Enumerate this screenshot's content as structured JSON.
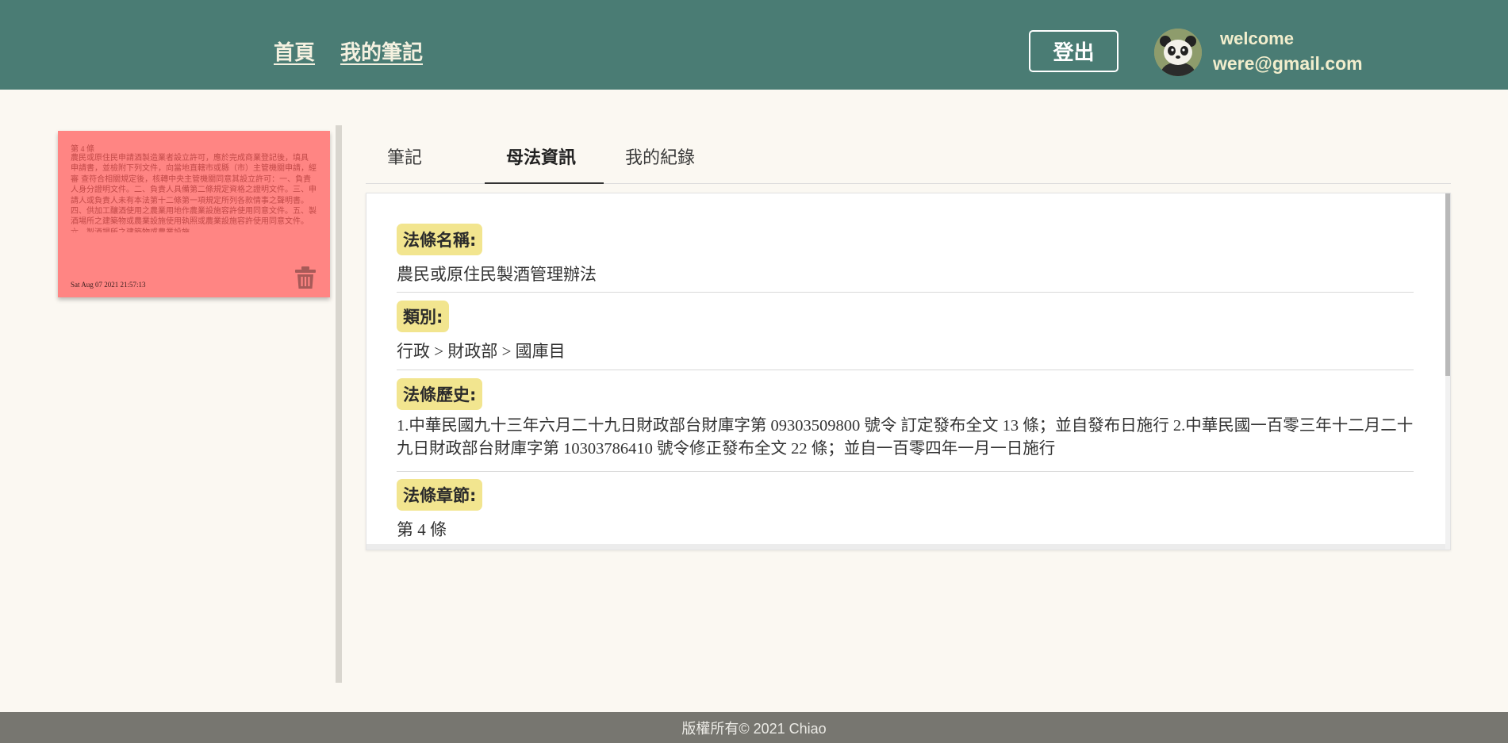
{
  "header": {
    "nav": {
      "home": "首頁",
      "my_notes": "我的筆記"
    },
    "logout_label": "登出",
    "welcome_text": "welcome",
    "email": "were@gmail.com"
  },
  "note_card": {
    "title": "第 4 條",
    "body": "農民或原住民申請酒製造業者設立許可，應於完成商業登記後，填具 申請書，並檢附下列文件，向當地直轄市或縣（市）主管機關申請，經審 查符合相關規定後，核轉中央主管機關同意其設立許可：一、負責人身分證明文件。二、負責人具備第二條規定資格之證明文件。三、申請人或負責人未有本法第十二條第一項規定所列各款情事之聲明書。 四、供加工釀酒使用之農業用地作農業設施容許使用同意文件。五、製酒場所之建築物或農業設施使用執照或農業設施容許使用同意文件。 六、製酒場所之建築物或農業設施",
    "date": "Sat Aug 07 2021 21:57:13",
    "delete_icon": "trash-icon"
  },
  "tabs": [
    {
      "label": "筆記",
      "active": false
    },
    {
      "label": "母法資訊",
      "active": true
    },
    {
      "label": "我的紀錄",
      "active": false
    }
  ],
  "law_info": {
    "name_label": "法條名稱:",
    "name_value": "農民或原住民製酒管理辦法",
    "category_label": "類別:",
    "category_value": "行政 > 財政部 > 國庫目",
    "history_label": "法條歷史:",
    "history_value": "1.中華民國九十三年六月二十九日財政部台財庫字第 09303509800 號令 訂定發布全文 13 條；並自發布日施行 2.中華民國一百零三年十二月二十九日財政部台財庫字第 10303786410 號令修正發布全文 22 條；並自一百零四年一月一日施行",
    "chapter_label": "法條章節:",
    "chapter_value": "第 4 條"
  },
  "footer": {
    "copyright": "版權所有© 2021 Chiao"
  },
  "colors": {
    "header_bg": "#4a7c74",
    "page_bg": "#fbf8f2",
    "note_bg": "#ff8583",
    "label_chip_bg": "#f2e58f",
    "footer_bg": "#777670"
  }
}
